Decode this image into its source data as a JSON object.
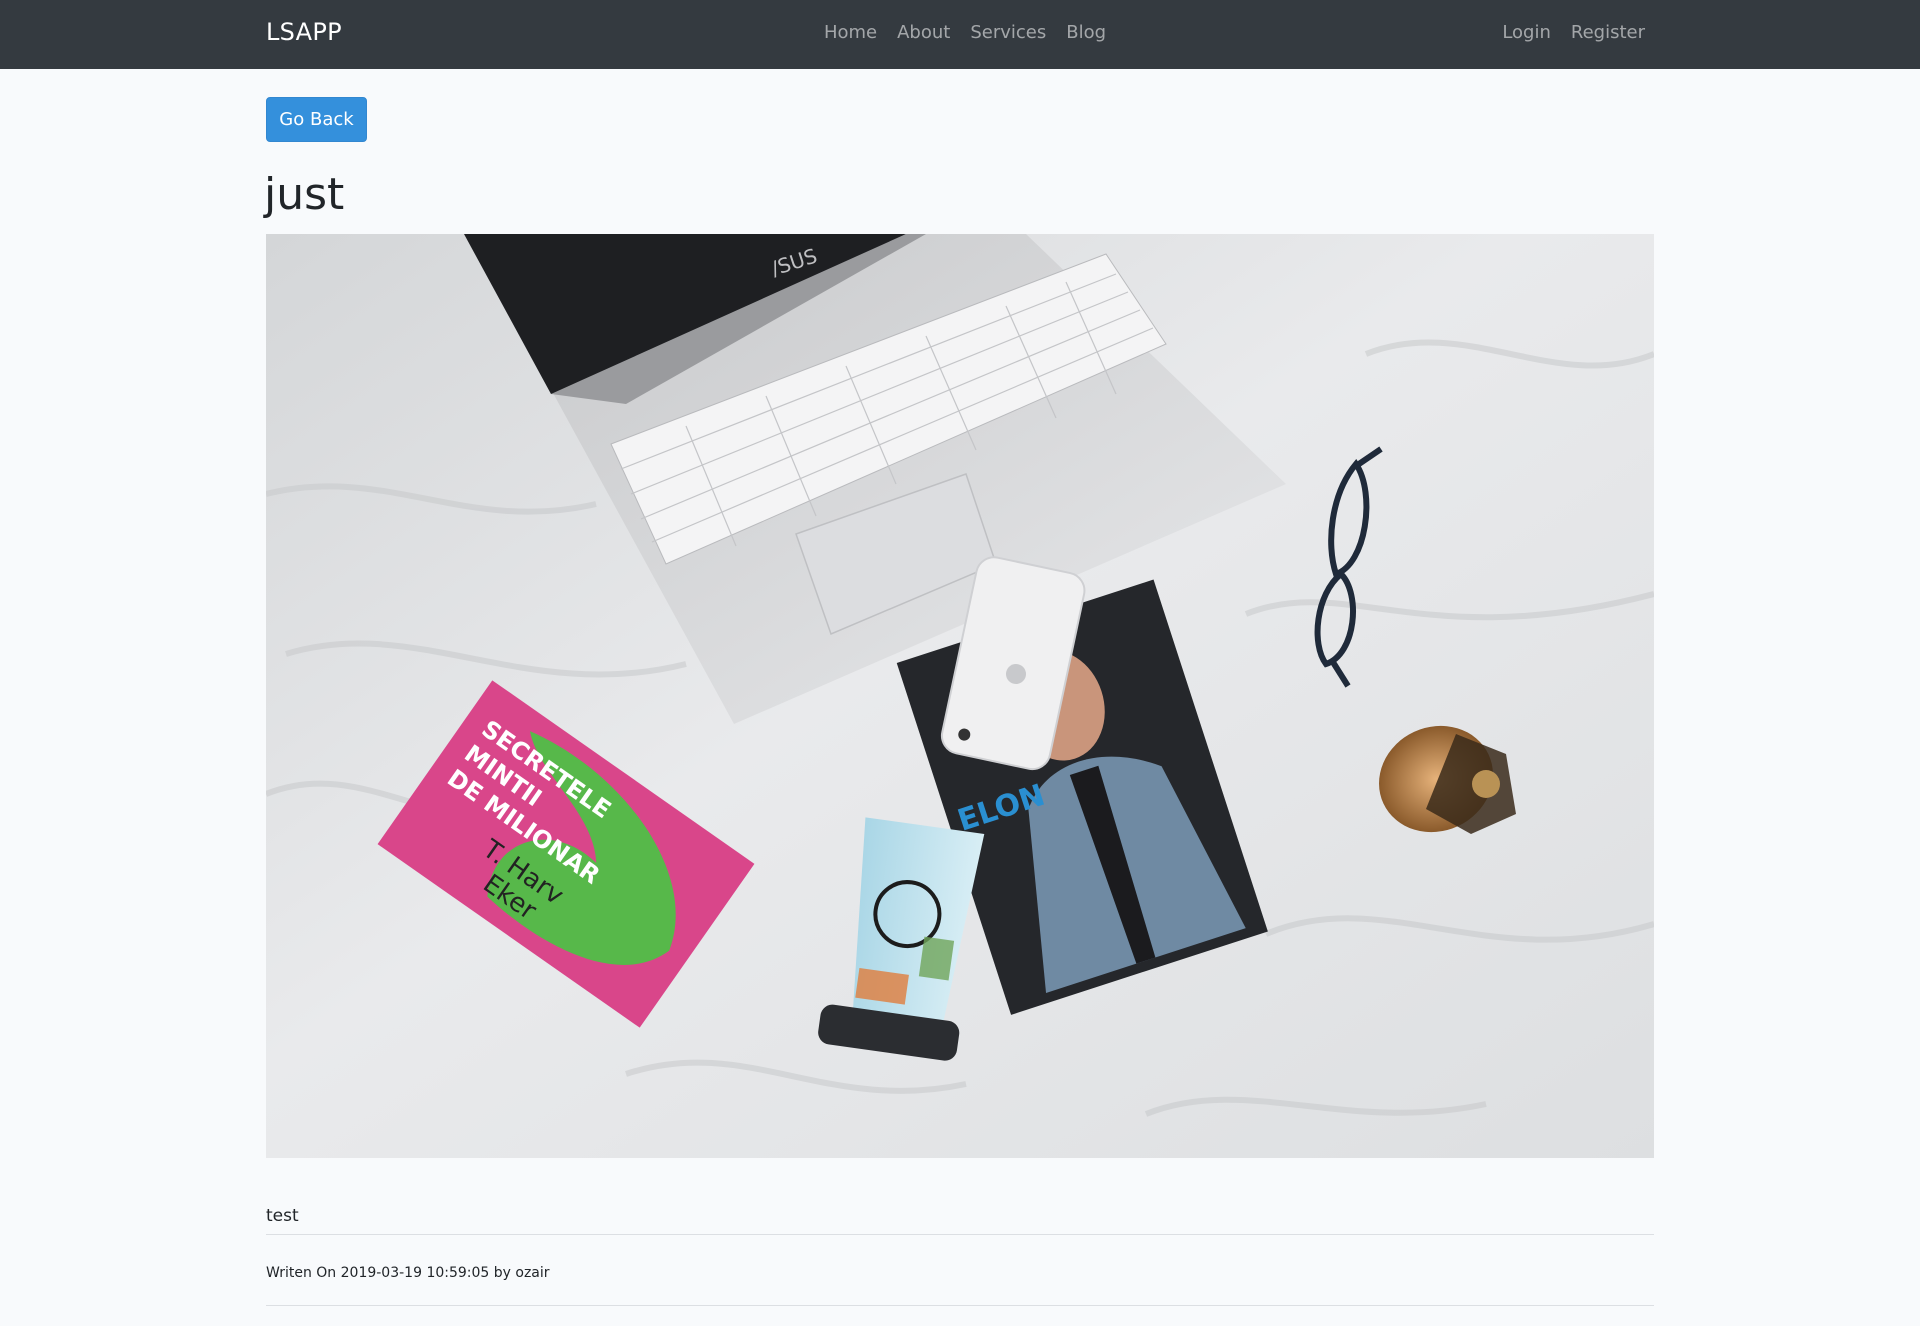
{
  "nav": {
    "brand": "LSAPP",
    "links": [
      "Home",
      "About",
      "Services",
      "Blog"
    ],
    "auth": [
      "Login",
      "Register"
    ]
  },
  "post": {
    "back_label": "Go Back",
    "title": "just",
    "body": "test",
    "meta": "Writen On 2019-03-19 10:59:05 by ozair",
    "image": {
      "book1_line1": "SECRETELE",
      "book1_line2": "MINTII",
      "book1_line3": "DE MILIONAR",
      "book1_author1": "T. Harv",
      "book1_author2": "Eker",
      "book2_title": "ELON",
      "laptop_logo": "/SUS"
    }
  },
  "colors": {
    "navbar": "#343a40",
    "primary": "#3490dc",
    "background": "#f8fafc"
  }
}
